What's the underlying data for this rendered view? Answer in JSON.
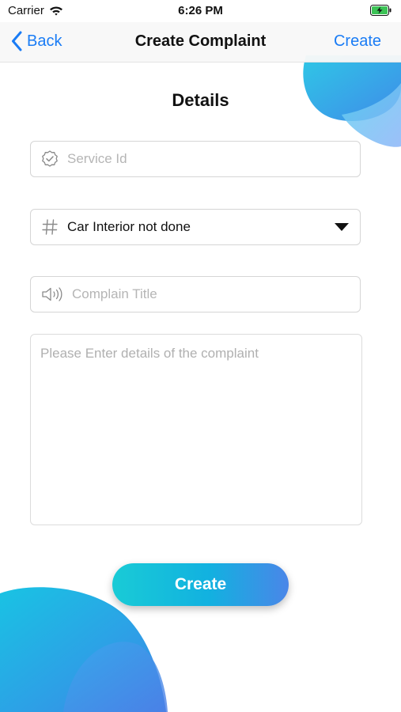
{
  "status_bar": {
    "carrier": "Carrier",
    "time": "6:26 PM"
  },
  "nav": {
    "back_label": "Back",
    "title": "Create Complaint",
    "action_label": "Create"
  },
  "form": {
    "section_title": "Details",
    "service_id": {
      "placeholder": "Service Id",
      "icon": "verified-badge-icon"
    },
    "category": {
      "value": "Car Interior not done",
      "icon": "hash-icon"
    },
    "complain_title": {
      "placeholder": "Complain Title",
      "icon": "speaker-icon"
    },
    "details": {
      "placeholder": "Please Enter details of the complaint"
    }
  },
  "submit_label": "Create",
  "colors": {
    "accent": "#1a7cf5",
    "gradient_start": "#19cbd6",
    "gradient_end": "#4a86e8"
  }
}
